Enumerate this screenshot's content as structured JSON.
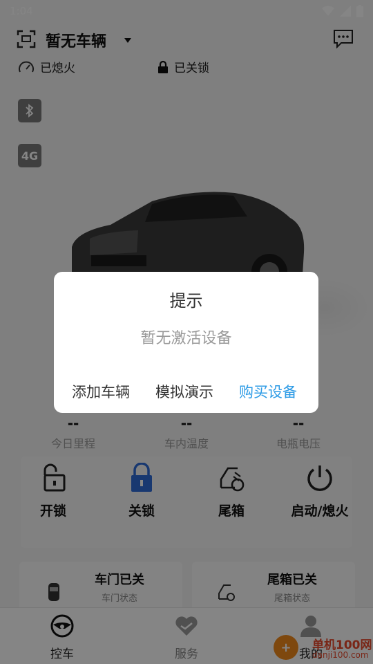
{
  "status_bar": {
    "time": "1:04"
  },
  "header": {
    "vehicle_title": "暂无车辆"
  },
  "status_row": {
    "engine": "已熄火",
    "lock": "已关锁"
  },
  "badges": {
    "network": "4G"
  },
  "metrics": [
    {
      "label": "今日里程"
    },
    {
      "label": "车内温度"
    },
    {
      "label": "电瓶电压"
    }
  ],
  "controls": [
    {
      "label": "开锁",
      "icon": "unlock-icon"
    },
    {
      "label": "关锁",
      "icon": "lock-icon",
      "color": "#2f6bd6"
    },
    {
      "label": "尾箱",
      "icon": "trunk-icon"
    },
    {
      "label": "启动/熄火",
      "icon": "power-icon"
    }
  ],
  "cards": {
    "door": {
      "title": "车门已关",
      "subtitle": "车门状态"
    },
    "trunk": {
      "title": "尾箱已关",
      "subtitle": "尾箱状态"
    }
  },
  "bottom_nav": [
    {
      "label": "控车"
    },
    {
      "label": "服务"
    },
    {
      "label": "我的"
    }
  ],
  "watermark": {
    "title": "单机100网",
    "url": "danji100.com"
  },
  "dialog": {
    "title": "提示",
    "message": "暂无激活设备",
    "buttons": {
      "add": "添加车辆",
      "demo": "模拟演示",
      "buy": "购买设备"
    },
    "accent_color": "#2d9be6"
  }
}
